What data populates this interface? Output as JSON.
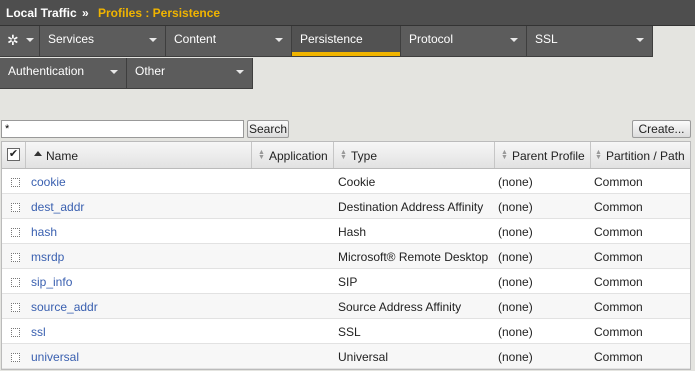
{
  "breadcrumb": {
    "section": "Local Traffic",
    "separator": "»",
    "page": "Profiles : Persistence"
  },
  "tabs_row1": [
    {
      "label": "Services"
    },
    {
      "label": "Content"
    },
    {
      "label": "Persistence",
      "active": true
    },
    {
      "label": "Protocol"
    },
    {
      "label": "SSL"
    }
  ],
  "tabs_row2": [
    {
      "label": "Authentication"
    },
    {
      "label": "Other"
    }
  ],
  "icons": {
    "settings": "gear-icon",
    "dropdown": "chevron-down-icon",
    "sort": "sort-icon"
  },
  "colors": {
    "accent": "#f0b400",
    "link": "#3a60b0",
    "tab": "#5c5c5c"
  },
  "search": {
    "value": "*",
    "button_label": "Search"
  },
  "create_button": "Create...",
  "table": {
    "columns": [
      "Name",
      "Application",
      "Type",
      "Parent Profile",
      "Partition / Path"
    ],
    "sorted_column": "Name",
    "rows": [
      {
        "name": "cookie",
        "application": "",
        "type": "Cookie",
        "parent": "(none)",
        "partition": "Common"
      },
      {
        "name": "dest_addr",
        "application": "",
        "type": "Destination Address Affinity",
        "parent": "(none)",
        "partition": "Common"
      },
      {
        "name": "hash",
        "application": "",
        "type": "Hash",
        "parent": "(none)",
        "partition": "Common"
      },
      {
        "name": "msrdp",
        "application": "",
        "type": "Microsoft® Remote Desktop",
        "parent": "(none)",
        "partition": "Common"
      },
      {
        "name": "sip_info",
        "application": "",
        "type": "SIP",
        "parent": "(none)",
        "partition": "Common"
      },
      {
        "name": "source_addr",
        "application": "",
        "type": "Source Address Affinity",
        "parent": "(none)",
        "partition": "Common"
      },
      {
        "name": "ssl",
        "application": "",
        "type": "SSL",
        "parent": "(none)",
        "partition": "Common"
      },
      {
        "name": "universal",
        "application": "",
        "type": "Universal",
        "parent": "(none)",
        "partition": "Common"
      }
    ]
  }
}
